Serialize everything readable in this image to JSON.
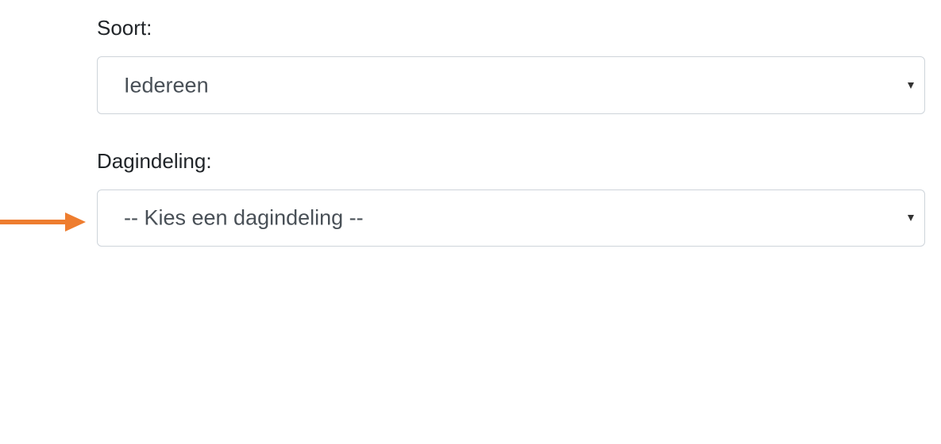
{
  "form": {
    "soort": {
      "label": "Soort:",
      "selected": "Iedereen"
    },
    "dagindeling": {
      "label": "Dagindeling:",
      "selected": "-- Kies een dagindeling --"
    }
  },
  "annotation": {
    "arrow_color": "#ee7d2f"
  },
  "icons": {
    "dropdown": "chevron-down-icon",
    "pointer": "arrow-right-icon"
  }
}
